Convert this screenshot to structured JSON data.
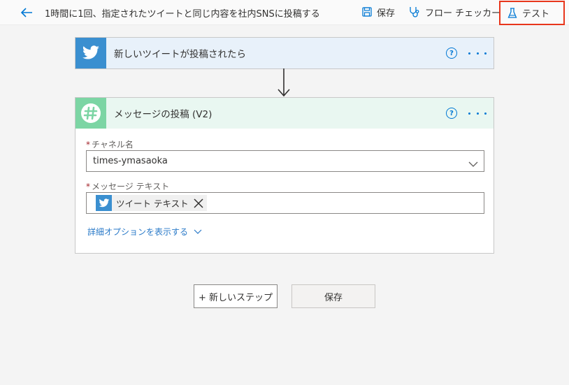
{
  "header": {
    "title": "1時間に1回、指定されたツイートと同じ内容を社内SNSに投稿する",
    "save_label": "保存",
    "checker_label": "フロー チェッカー",
    "test_label": "テスト",
    "icons": {
      "back": "back-arrow-icon",
      "save": "floppy-disk-icon",
      "checker": "stethoscope-icon",
      "test": "flask-icon"
    }
  },
  "trigger": {
    "title": "新しいツイートが投稿されたら",
    "icon": "twitter-icon"
  },
  "action": {
    "title": "メッセージの投稿 (V2)",
    "icon": "slack-icon",
    "channel_label": "チャネル名",
    "channel_value": "times-ymasaoka",
    "message_label": "メッセージ テキスト",
    "message_token": "ツイート テキスト",
    "advanced_link": "詳細オプションを表示する"
  },
  "buttons": {
    "new_step": "+ 新しいステップ",
    "save": "保存"
  },
  "colors": {
    "accent": "#0078d4",
    "twitter": "#3a8fd0",
    "slack": "#7cd5a4",
    "highlight": "#e8361c"
  }
}
